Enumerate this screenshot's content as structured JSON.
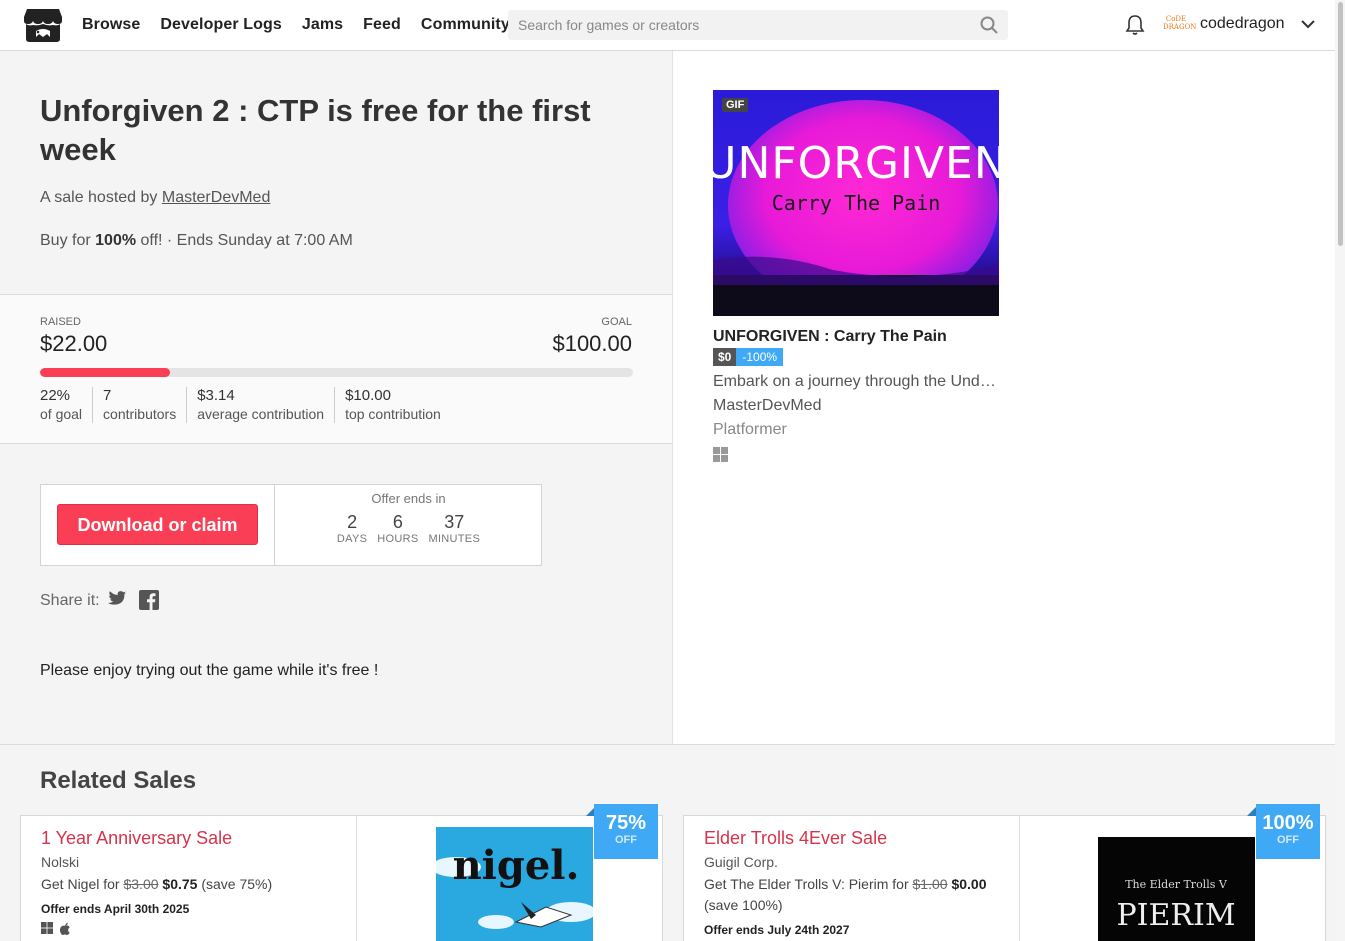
{
  "header": {
    "nav": [
      "Browse",
      "Developer Logs",
      "Jams",
      "Feed",
      "Community"
    ],
    "search_placeholder": "Search for games or creators",
    "avatar_text": "CoDE DRAGON",
    "username": "codedragon"
  },
  "sale": {
    "title": "Unforgiven 2 : CTP is free for the first week",
    "hosted_prefix": "A sale hosted by ",
    "host": "MasterDevMed",
    "buy_prefix": "Buy for ",
    "discount": "100%",
    "buy_suffix": " off! · Ends Sunday at 7:00 AM",
    "raised_label": "RAISED",
    "raised_value": "$22.00",
    "goal_label": "GOAL",
    "goal_value": "$100.00",
    "progress_fraction": 0.22,
    "stats": [
      {
        "value": "22%",
        "label": "of goal"
      },
      {
        "value": "7",
        "label": "contributors"
      },
      {
        "value": "$3.14",
        "label": "average contribution"
      },
      {
        "value": "$10.00",
        "label": "top contribution"
      }
    ],
    "claim_button": "Download or claim",
    "offer_label": "Offer ends in",
    "countdown": [
      {
        "n": "2",
        "u": "DAYS"
      },
      {
        "n": "6",
        "u": "HOURS"
      },
      {
        "n": "37",
        "u": "MINUTES"
      }
    ],
    "share_label": "Share it:",
    "message": "Please enjoy trying out the game while it's free !"
  },
  "game": {
    "gif_tag": "GIF",
    "cover_title": "UNFORGIVEN",
    "cover_subtitle": "Carry The Pain",
    "title": "UNFORGIVEN : Carry The Pain",
    "price": "$0",
    "discount": "-100%",
    "description": "Embark on a journey through the Unde…",
    "author": "MasterDevMed",
    "genre": "Platformer",
    "platform_icon": "windows-icon"
  },
  "related": {
    "heading": "Related Sales",
    "items": [
      {
        "title": "1 Year Anniversary Sale",
        "author": "Nolski",
        "price_prefix": "Get Nigel for ",
        "old_price": "$3.00",
        "new_price": "$0.75",
        "save": "(save 75%)",
        "ends": "Offer ends April 30th 2025",
        "badge_pct": "75%",
        "badge_off": "OFF",
        "thumb_text": "nigel."
      },
      {
        "title": "Elder Trolls 4Ever Sale",
        "author": "Guigil Corp.",
        "price_prefix": "Get The Elder Trolls V: Pierim for ",
        "old_price": "$1.00",
        "new_price": "$0.00",
        "save": "(save 100%)",
        "ends": "Offer ends July 24th 2027",
        "badge_pct": "100%",
        "badge_off": "OFF",
        "thumb_text_top": "The Elder Trolls V",
        "thumb_text_main": "PIERIM"
      }
    ]
  },
  "colors": {
    "accent": "#fa3e55",
    "badge_blue": "#3fa9f5",
    "panel_bg": "#f4f4f4"
  }
}
